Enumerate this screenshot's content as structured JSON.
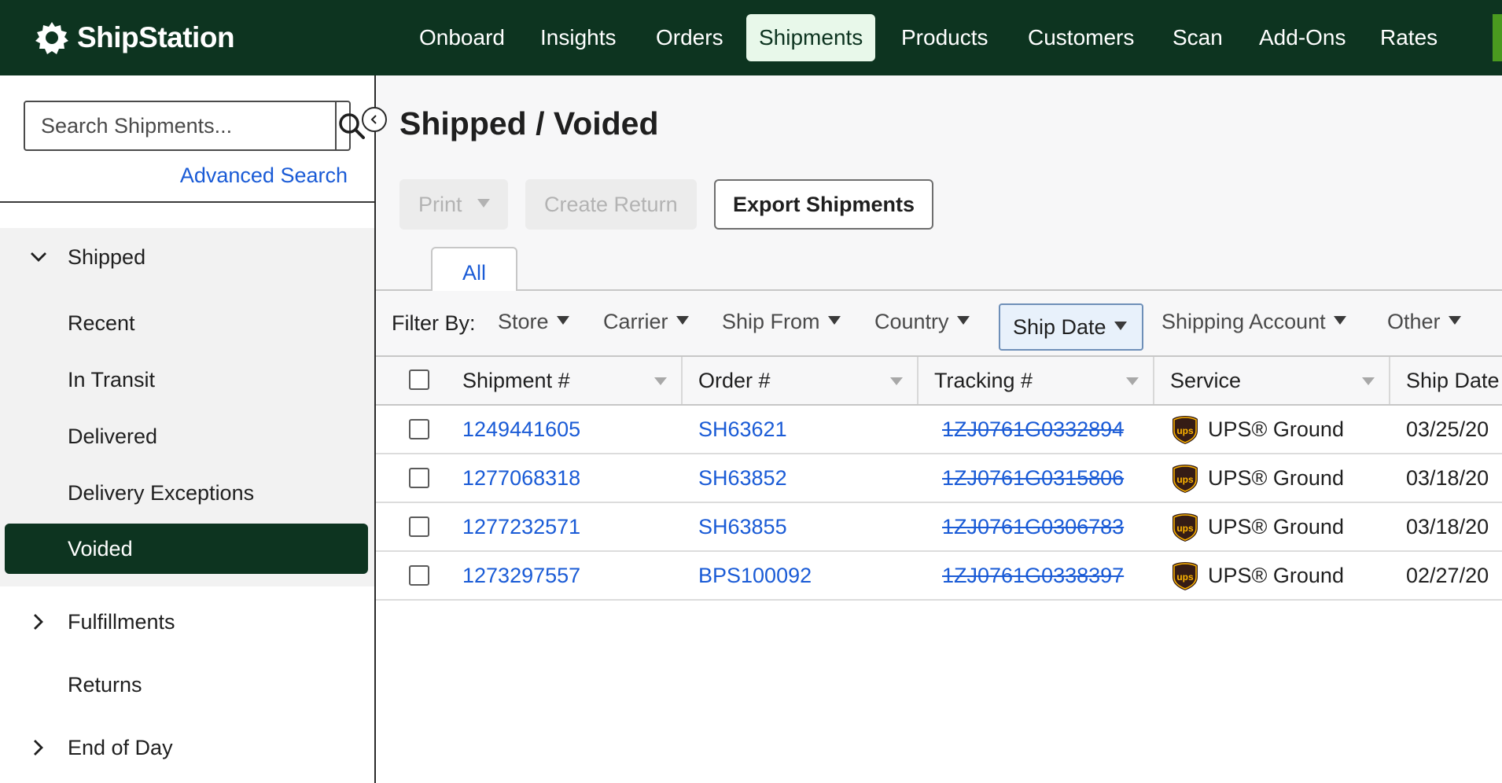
{
  "brand": {
    "name": "ShipStation"
  },
  "nav": {
    "items": [
      {
        "label": "Onboard",
        "active": false
      },
      {
        "label": "Insights",
        "active": false
      },
      {
        "label": "Orders",
        "active": false
      },
      {
        "label": "Shipments",
        "active": true
      },
      {
        "label": "Products",
        "active": false
      },
      {
        "label": "Customers",
        "active": false
      },
      {
        "label": "Scan",
        "active": false
      },
      {
        "label": "Add-Ons",
        "active": false
      },
      {
        "label": "Rates",
        "active": false
      }
    ]
  },
  "sidebar": {
    "search": {
      "placeholder": "Search Shipments...",
      "value": ""
    },
    "advanced_search": "Advanced Search",
    "shipped": {
      "label": "Shipped",
      "expanded": true,
      "children": [
        "Recent",
        "In Transit",
        "Delivered",
        "Delivery Exceptions",
        "Voided"
      ],
      "active": "Voided"
    },
    "fulfillments": "Fulfillments",
    "returns": "Returns",
    "end_of_day": "End of Day"
  },
  "page": {
    "title": "Shipped / Voided",
    "actions": {
      "print": "Print",
      "create_return": "Create Return",
      "export": "Export Shipments"
    },
    "tabs": [
      {
        "label": "All",
        "active": true
      }
    ]
  },
  "filters": {
    "label": "Filter By:",
    "items": [
      "Store",
      "Carrier",
      "Ship From",
      "Country",
      "Ship Date",
      "Shipping Account",
      "Other"
    ],
    "active": "Ship Date"
  },
  "table": {
    "columns": [
      "Shipment #",
      "Order #",
      "Tracking #",
      "Service",
      "Ship Date"
    ],
    "rows": [
      {
        "shipment": "1249441605",
        "order": "SH63621",
        "tracking": "1ZJ0761G0332894",
        "service": "UPS® Ground",
        "ship_date": "03/25/20"
      },
      {
        "shipment": "1277068318",
        "order": "SH63852",
        "tracking": "1ZJ0761G0315806",
        "service": "UPS® Ground",
        "ship_date": "03/18/20"
      },
      {
        "shipment": "1277232571",
        "order": "SH63855",
        "tracking": "1ZJ0761G0306783",
        "service": "UPS® Ground",
        "ship_date": "03/18/20"
      },
      {
        "shipment": "1273297557",
        "order": "BPS100092",
        "tracking": "1ZJ0761G0338397",
        "service": "UPS® Ground",
        "ship_date": "02/27/20"
      }
    ]
  },
  "colors": {
    "nav_bg": "#0d3420",
    "accent_link": "#1a5bd6",
    "active_nav_bg": "#e8f8ea",
    "ups_brown": "#351c15",
    "ups_gold": "#ffb500"
  }
}
